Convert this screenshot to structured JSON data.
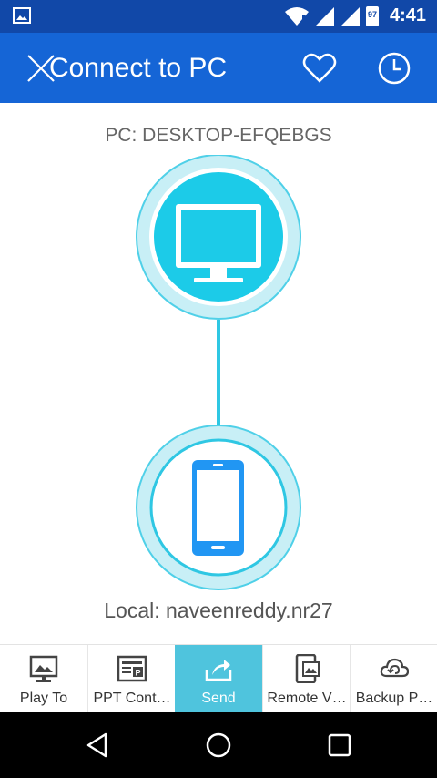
{
  "status_bar": {
    "time": "4:41",
    "battery": "97"
  },
  "app_bar": {
    "title": "Connect to PC"
  },
  "pc_label": "PC: DESKTOP-EFQEBGS",
  "local_label": "Local: naveenreddy.nr27",
  "tabs": [
    {
      "label": "Play To",
      "icon": "picture-frame-icon",
      "active": false
    },
    {
      "label": "PPT Cont…",
      "icon": "presentation-icon",
      "active": false
    },
    {
      "label": "Send",
      "icon": "send-share-icon",
      "active": true
    },
    {
      "label": "Remote V…",
      "icon": "remote-phone-image-icon",
      "active": false
    },
    {
      "label": "Backup P…",
      "icon": "cloud-backup-icon",
      "active": false
    }
  ],
  "colors": {
    "status_bar": "#1148a8",
    "app_bar": "#1565d6",
    "pc_circle": "#1ccbe8",
    "phone_blue": "#2196f3",
    "active_tab": "#4fc4dd"
  }
}
